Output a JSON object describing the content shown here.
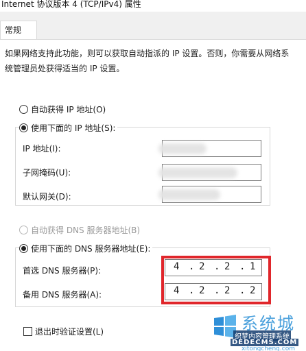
{
  "window": {
    "title": "Internet 协议版本 4 (TCP/IPv4) 属性"
  },
  "tabs": [
    {
      "label": "常规"
    }
  ],
  "description": "如果网络支持此功能，则可以获取自动指派的 IP 设置。否则，你需要从网络系统管理员处获得适当的 IP 设置。",
  "ip_section": {
    "auto_label": "自动获得 IP 地址(O)",
    "manual_label": "使用下面的 IP 地址(S):",
    "mode": "manual",
    "fields": [
      {
        "label": "IP 地址(I):"
      },
      {
        "label": "子网掩码(U):"
      },
      {
        "label": "默认网关(D):"
      }
    ]
  },
  "dns_section": {
    "auto_label": "自动获得 DNS 服务器地址(B)",
    "manual_label": "使用下面的 DNS 服务器地址(E):",
    "mode": "manual",
    "preferred": {
      "label": "首选 DNS 服务器(P):",
      "octets": [
        "4",
        "2",
        "2",
        "1"
      ]
    },
    "alternate": {
      "label": "备用 DNS 服务器(A):",
      "octets": [
        "4",
        "2",
        "2",
        "2"
      ]
    }
  },
  "validate_on_exit": {
    "label": "退出时验证设置(L)",
    "checked": false
  },
  "watermark": {
    "title": "系统城",
    "line1": "织梦内容管理系统",
    "line2": "DEDECMS.COM",
    "line3": "xitongcheng.com"
  },
  "colors": {
    "highlight_box": "#e0262b",
    "watermark": "#4aa0dc"
  }
}
